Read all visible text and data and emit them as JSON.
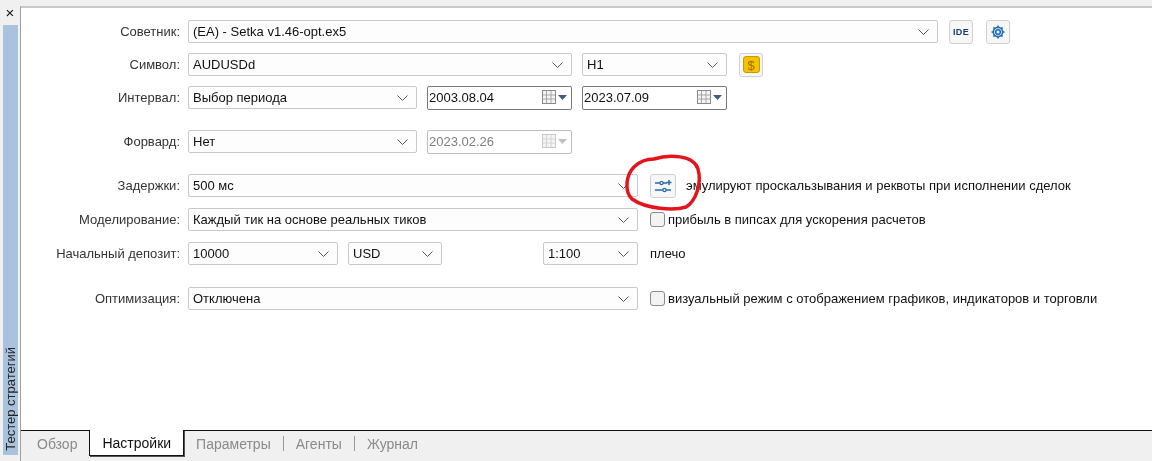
{
  "side_panel": {
    "close": "×",
    "title": "Тестер стратегий"
  },
  "rows": [
    {
      "label": "Советник:",
      "controls": [
        {
          "kind": "combo",
          "value": "(EA) - Setka v1.46-opt.ex5"
        },
        {
          "kind": "text_button",
          "text": "IDE"
        },
        {
          "kind": "gear_button"
        }
      ]
    },
    {
      "label": "Символ:",
      "controls": [
        {
          "kind": "combo",
          "value": "AUDUSDd"
        },
        {
          "kind": "combo",
          "value": "H1"
        },
        {
          "kind": "dollar_button",
          "text": "$"
        }
      ]
    },
    {
      "label": "Интервал:",
      "controls": [
        {
          "kind": "combo",
          "value": "Выбор периода"
        },
        {
          "kind": "date",
          "value": "2003.08.04",
          "disabled": false
        },
        {
          "kind": "date",
          "value": "2023.07.09",
          "disabled": false
        }
      ]
    },
    {
      "label": "Форвард:",
      "controls": [
        {
          "kind": "combo",
          "value": "Нет"
        },
        {
          "kind": "date",
          "value": "2023.02.26",
          "disabled": true
        }
      ]
    },
    {
      "label": "Задержки:",
      "controls": [
        {
          "kind": "combo",
          "value": "500 мс"
        },
        {
          "kind": "sliders_button"
        },
        {
          "kind": "note",
          "text": "эмулируют проскальзывания и реквоты при исполнении сделок"
        }
      ]
    },
    {
      "label": "Моделирование:",
      "controls": [
        {
          "kind": "combo",
          "value": "Каждый тик на основе реальных тиков"
        },
        {
          "kind": "checkbox",
          "checked": false,
          "text": "прибыль в пипсах для ускорения расчетов"
        }
      ]
    },
    {
      "label": "Начальный депозит:",
      "controls": [
        {
          "kind": "combo",
          "value": "10000"
        },
        {
          "kind": "combo",
          "value": "USD"
        },
        {
          "kind": "combo",
          "value": "1:100"
        },
        {
          "kind": "note",
          "text": "плечо"
        }
      ]
    },
    {
      "label": "Оптимизация:",
      "controls": [
        {
          "kind": "combo",
          "value": "Отключена"
        },
        {
          "kind": "checkbox",
          "checked": false,
          "text": "визуальный режим с отображением графиков, индикаторов и торговли"
        }
      ]
    }
  ],
  "tabs": [
    {
      "label": "Обзор",
      "selected": false
    },
    {
      "label": "Настройки",
      "selected": true
    },
    {
      "label": "Параметры",
      "selected": false
    },
    {
      "label": "Агенты",
      "selected": false
    },
    {
      "label": "Журнал",
      "selected": false
    }
  ]
}
